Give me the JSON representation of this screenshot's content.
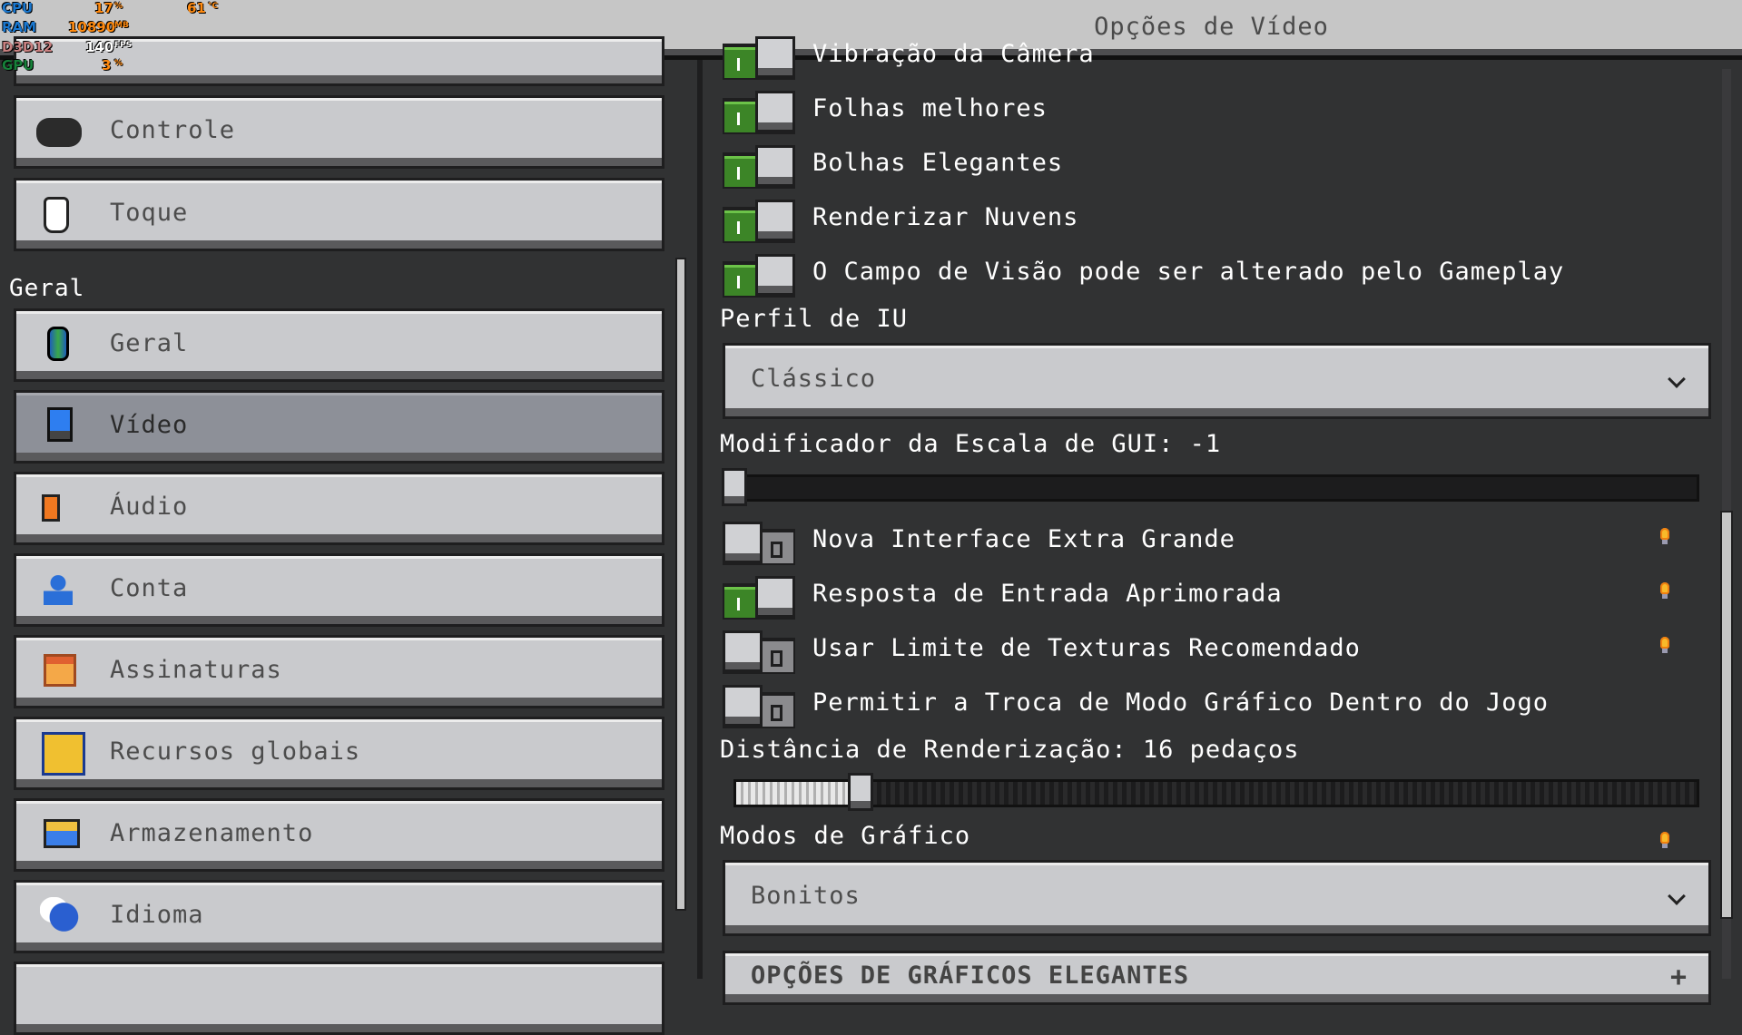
{
  "title": "Opções de Vídeo",
  "hud": {
    "cpu_label": "CPU",
    "cpu_value": "17",
    "cpu_unit": "%",
    "cpu_temp": "61",
    "cpu_temp_unit": "°C",
    "ram_label": "RAM",
    "ram_value": "10890",
    "ram_unit": "MB",
    "api_label": "D3D12",
    "fps_value": "140",
    "fps_unit": "FPS",
    "gpu_label": "GPU",
    "gpu_value": "3",
    "gpu_unit": "%"
  },
  "sidebar": {
    "items_top": [
      {
        "label": "Controle",
        "icon": "gamepad-icon"
      },
      {
        "label": "Toque",
        "icon": "hand-icon"
      }
    ],
    "section_label": "Geral",
    "items": [
      {
        "label": "Geral",
        "icon": "globe-icon"
      },
      {
        "label": "Vídeo",
        "icon": "monitor-icon",
        "selected": true
      },
      {
        "label": "Áudio",
        "icon": "speaker-icon"
      },
      {
        "label": "Conta",
        "icon": "user-icon"
      },
      {
        "label": "Assinaturas",
        "icon": "calendar-icon"
      },
      {
        "label": "Recursos globais",
        "icon": "resource-pack-icon"
      },
      {
        "label": "Armazenamento",
        "icon": "folder-icon"
      },
      {
        "label": "Idioma",
        "icon": "language-icon"
      }
    ]
  },
  "main": {
    "toggles_top": [
      {
        "label": "Vibração da Câmera",
        "on": true
      },
      {
        "label": "Folhas melhores",
        "on": true
      },
      {
        "label": "Bolhas Elegantes",
        "on": true
      },
      {
        "label": "Renderizar Nuvens",
        "on": true
      },
      {
        "label": "O Campo de Visão pode ser alterado pelo Gameplay",
        "on": true
      }
    ],
    "ui_profile_label": "Perfil de IU",
    "ui_profile_value": "Clássico",
    "gui_scale_label": "Modificador da Escala de GUI: -1",
    "gui_scale_fraction": 0,
    "toggles_mid": [
      {
        "label": "Nova Interface Extra Grande",
        "on": false
      },
      {
        "label": "Resposta de Entrada Aprimorada",
        "on": true
      },
      {
        "label": "Usar Limite de Texturas Recomendado",
        "on": false
      },
      {
        "label": "Permitir a Troca de Modo Gráfico Dentro do Jogo",
        "on": false
      }
    ],
    "render_distance_label": "Distância de Renderização: 16 pedaços",
    "render_distance_fraction": 0.12,
    "graphics_mode_label": "Modos de Gráfico",
    "graphics_mode_value": "Bonitos",
    "fancy_section_label": "OPÇÕES DE GRÁFICOS ELEGANTES"
  }
}
